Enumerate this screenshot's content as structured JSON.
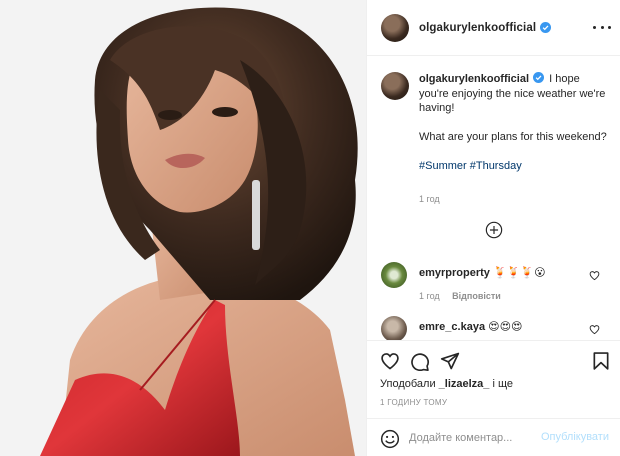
{
  "header": {
    "username": "olgakurylenkoofficial",
    "verified_icon": "verified-badge-icon",
    "more_icon": "more-options-icon"
  },
  "caption": {
    "username": "olgakurylenkoofficial",
    "line1": "I hope you're enjoying the nice weather we're having!",
    "line2": "What are your plans for this weekend?",
    "hashtags": "#Summer #Thursday",
    "time": "1 год"
  },
  "load_more_icon": "add-circle-icon",
  "comments": [
    {
      "username": "emyrproperty",
      "text": "🍹🍹🍹😮",
      "time": "1 год",
      "reply_label": "Відповісти"
    },
    {
      "username": "emre_c.kaya",
      "text": "😍😍😍"
    }
  ],
  "actions": {
    "like_icon": "heart-icon",
    "comment_icon": "comment-icon",
    "share_icon": "send-icon",
    "save_icon": "bookmark-icon"
  },
  "likes": {
    "prefix": "Уподобали",
    "user": "_lizaelza_",
    "suffix": "і ще"
  },
  "posted_ago": "1 ГОДИНУ ТОМУ",
  "comment_box": {
    "placeholder": "Додайте коментар...",
    "post_label": "Опублікувати"
  },
  "colors": {
    "accent_blue": "#0095f6",
    "post_disabled": "#b2dffc",
    "hashtag": "#00376b",
    "muted": "#8e8e8e"
  }
}
